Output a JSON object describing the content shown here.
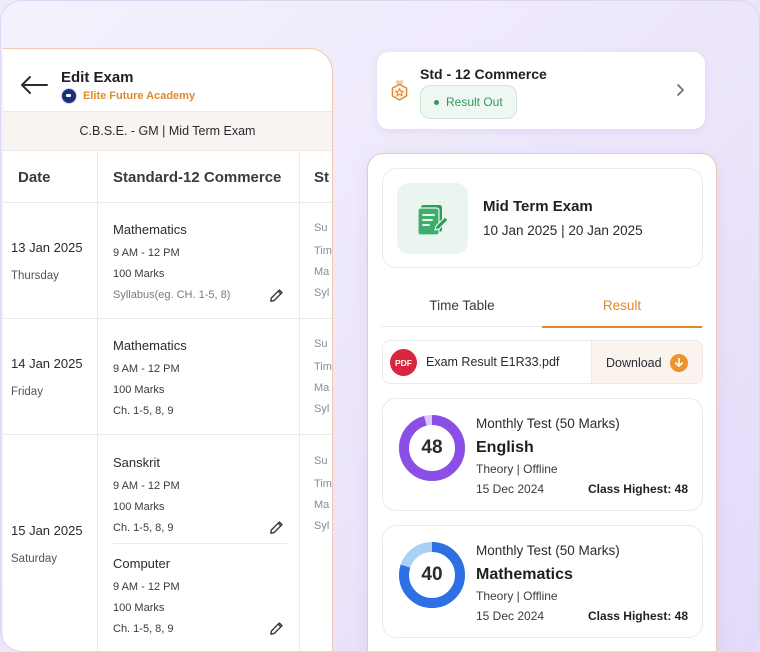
{
  "left_panel": {
    "title": "Edit Exam",
    "school_name": "Elite Future Academy",
    "exam_strip": "C.B.S.E. - GM | Mid Term Exam",
    "columns": [
      "Date",
      "Standard-12 Commerce",
      "St"
    ],
    "rows": [
      {
        "date": "13 Jan 2025",
        "day": "Thursday",
        "subjects": [
          {
            "name": "Mathematics",
            "time": "9 AM - 12 PM",
            "marks": "100 Marks",
            "syllabus": "Syllabus(eg. CH. 1-5, 8)"
          }
        ],
        "ghost": [
          "Su",
          "Tim",
          "Ma",
          "Syl"
        ]
      },
      {
        "date": "14 Jan 2025",
        "day": "Friday",
        "subjects": [
          {
            "name": "Mathematics",
            "time": "9 AM - 12 PM",
            "marks": "100 Marks",
            "syllabus": "Ch. 1-5, 8, 9"
          }
        ],
        "ghost": [
          "Su",
          "Tim",
          "Ma",
          "Syl"
        ]
      },
      {
        "date": "15 Jan 2025",
        "day": "Saturday",
        "subjects": [
          {
            "name": "Sanskrit",
            "time": "9 AM - 12 PM",
            "marks": "100 Marks",
            "syllabus": "Ch. 1-5, 8, 9"
          },
          {
            "name": "Computer",
            "time": "9 AM - 12 PM",
            "marks": "100 Marks",
            "syllabus": "Ch. 1-5, 8, 9"
          }
        ],
        "ghost": [
          "Su",
          "Tim",
          "Ma",
          "Syl"
        ]
      }
    ]
  },
  "std_card": {
    "title": "Std - 12 Commerce",
    "status": "Result Out"
  },
  "exam": {
    "title": "Mid Term Exam",
    "dates": "10 Jan 2025 | 20 Jan 2025"
  },
  "tabs": [
    {
      "label": "Time Table",
      "active": false
    },
    {
      "label": "Result",
      "active": true
    }
  ],
  "pdf": {
    "badge": "PDF",
    "file_name": "Exam Result E1R33.pdf",
    "download_label": "Download"
  },
  "results": [
    {
      "test": "Monthly Test (50 Marks)",
      "subject": "English",
      "mode": "Theory | Offline",
      "date": "15 Dec 2024",
      "class_highest": "Class Highest: 48",
      "score": "48",
      "score_fraction": 0.96,
      "color": "#8b4fe6",
      "track": "#dcc8f7"
    },
    {
      "test": "Monthly Test (50 Marks)",
      "subject": "Mathematics",
      "mode": "Theory | Offline",
      "date": "15 Dec 2024",
      "class_highest": "Class Highest: 48",
      "score": "40",
      "score_fraction": 0.8,
      "color": "#2f6fe4",
      "track": "#a9d1f5"
    }
  ],
  "colors": {
    "accent": "#e08a2c",
    "success": "#2f9a5b",
    "pdf_red": "#d7263d"
  }
}
